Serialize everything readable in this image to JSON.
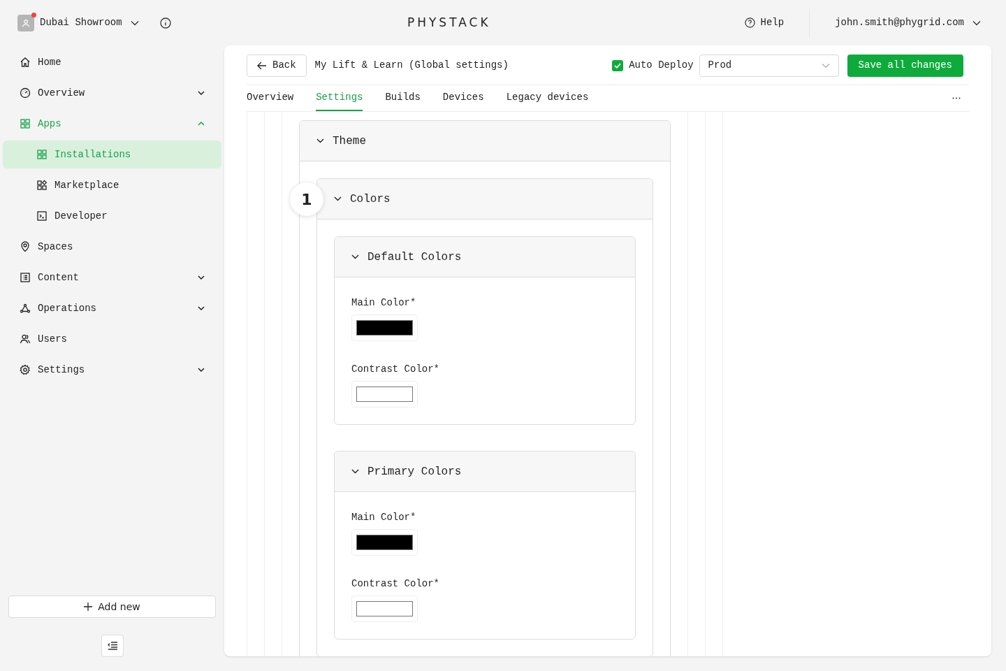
{
  "workspace": {
    "name": "Dubai Showroom",
    "notification": true
  },
  "logo": "PHYSTACK",
  "help": "Help",
  "user": "john.smith@phygrid.com",
  "sidebar": {
    "items": [
      {
        "label": "Home",
        "selected": false
      },
      {
        "label": "Overview",
        "selected": false,
        "expanded": false
      },
      {
        "label": "Apps",
        "selected": false,
        "expanded": true,
        "children": [
          {
            "label": "Installations",
            "selected": true
          },
          {
            "label": "Marketplace",
            "selected": false
          },
          {
            "label": "Developer",
            "selected": false
          }
        ]
      },
      {
        "label": "Spaces",
        "selected": false
      },
      {
        "label": "Content",
        "selected": false,
        "expanded": false
      },
      {
        "label": "Operations",
        "selected": false,
        "expanded": false
      },
      {
        "label": "Users",
        "selected": false
      },
      {
        "label": "Settings",
        "selected": false,
        "expanded": false
      }
    ],
    "add_button": "Add new"
  },
  "header": {
    "back": "Back",
    "title": "My Lift & Learn (Global settings)",
    "auto_deploy": {
      "label": "Auto Deploy",
      "checked": true
    },
    "environment": "Prod",
    "save": "Save all changes"
  },
  "tabs": [
    {
      "label": "Overview",
      "selected": false
    },
    {
      "label": "Settings",
      "selected": true
    },
    {
      "label": "Builds",
      "selected": false
    },
    {
      "label": "Devices",
      "selected": false
    },
    {
      "label": "Legacy devices",
      "selected": false
    }
  ],
  "step_badge": "1",
  "sections": [
    {
      "title": "Theme",
      "expanded": true,
      "children": [
        {
          "title": "Colors",
          "expanded": true,
          "children": [
            {
              "title": "Default Colors",
              "expanded": true,
              "fields": [
                {
                  "label": "Main Color*",
                  "color": "#000000"
                },
                {
                  "label": "Contrast Color*",
                  "color": "#ffffff"
                }
              ]
            },
            {
              "title": "Primary Colors",
              "expanded": true,
              "fields": [
                {
                  "label": "Main Color*",
                  "color": "#000000"
                },
                {
                  "label": "Contrast Color*",
                  "color": "#ffffff"
                }
              ]
            }
          ]
        }
      ]
    }
  ]
}
